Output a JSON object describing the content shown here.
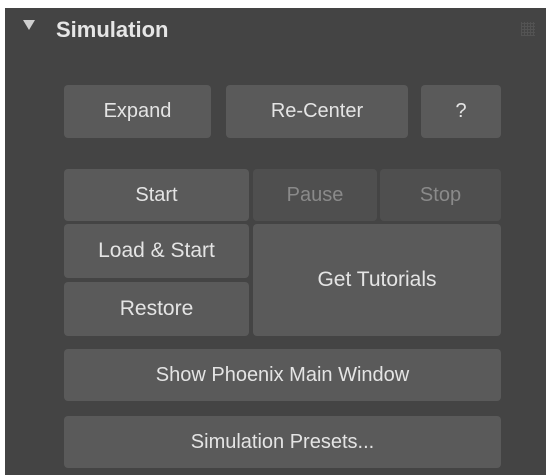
{
  "rollout": {
    "title": "Simulation"
  },
  "buttons": {
    "expand": "Expand",
    "recenter": "Re-Center",
    "help": "?",
    "start": "Start",
    "pause": "Pause",
    "stop": "Stop",
    "load_start": "Load & Start",
    "restore": "Restore",
    "get_tutorials": "Get Tutorials",
    "show_main_window": "Show Phoenix Main Window",
    "presets": "Simulation Presets..."
  },
  "state": {
    "pause_enabled": false,
    "stop_enabled": false
  },
  "colors": {
    "panel_bg": "#444444",
    "button_bg": "#5a5a5a",
    "button_text": "#e4e4e4",
    "disabled_text": "#8a8a8a"
  },
  "icons": {
    "collapse": "triangle-down-icon",
    "grip": "grip-icon"
  }
}
